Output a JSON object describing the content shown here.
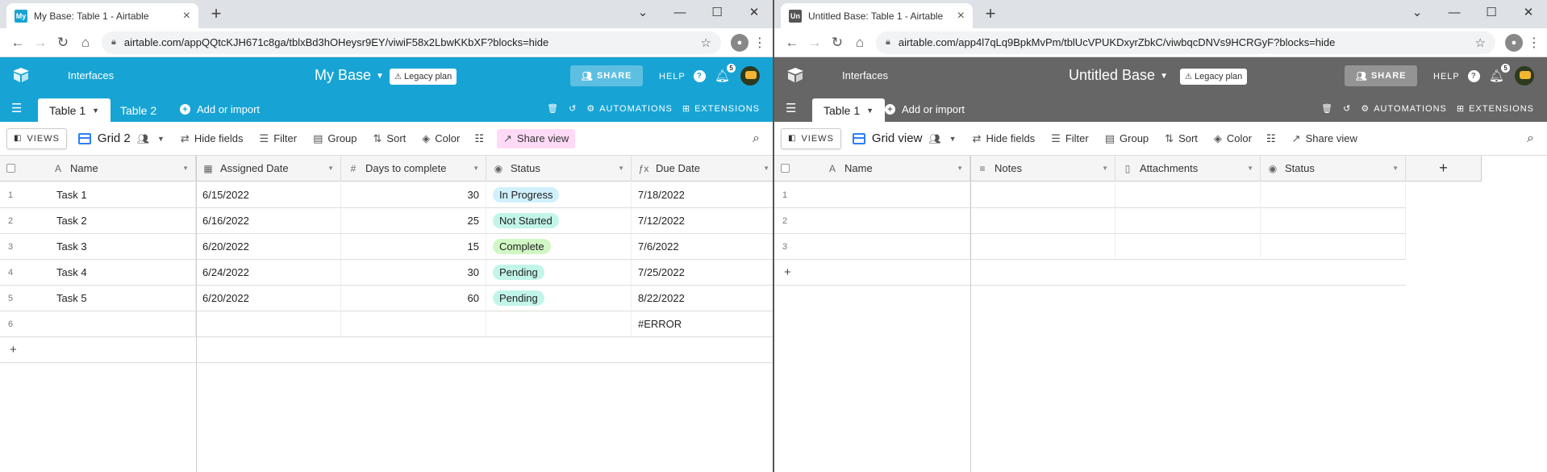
{
  "left": {
    "browser_tab_title": "My Base: Table 1 - Airtable",
    "favicon_text": "My",
    "url": "airtable.com/appQQtcKJH671c8ga/tblxBd3hOHeysr9EY/viwiF58x2LbwKKbXF?blocks=hide",
    "header_color": "#17a4d4",
    "interfaces_label": "Interfaces",
    "base_name": "My Base",
    "legacy_label": "Legacy plan",
    "share_label": "SHARE",
    "help_label": "HELP",
    "notif_count": "5",
    "tabs": [
      {
        "label": "Table 1",
        "active": true
      },
      {
        "label": "Table 2",
        "active": false
      }
    ],
    "add_import_label": "Add or import",
    "automations_label": "AUTOMATIONS",
    "extensions_label": "EXTENSIONS",
    "views_label": "VIEWS",
    "view_name": "Grid 2",
    "toolbar": {
      "hide_fields": "Hide fields",
      "filter": "Filter",
      "group": "Group",
      "sort": "Sort",
      "color": "Color",
      "share_view": "Share view"
    },
    "columns": [
      {
        "name": "Name",
        "icon": "A"
      },
      {
        "name": "Assigned Date",
        "icon": "▦"
      },
      {
        "name": "Days to complete",
        "icon": "#"
      },
      {
        "name": "Status",
        "icon": "◉"
      },
      {
        "name": "Due Date",
        "icon": "ƒx"
      }
    ],
    "rows": [
      {
        "n": "1",
        "name": "Task 1",
        "assigned": "6/15/2022",
        "days": "30",
        "status": "In Progress",
        "status_color": "#d0f0fd",
        "due": "7/18/2022"
      },
      {
        "n": "2",
        "name": "Task 2",
        "assigned": "6/16/2022",
        "days": "25",
        "status": "Not Started",
        "status_color": "#c2f5e9",
        "due": "7/12/2022"
      },
      {
        "n": "3",
        "name": "Task 3",
        "assigned": "6/20/2022",
        "days": "15",
        "status": "Complete",
        "status_color": "#d1f7c4",
        "due": "7/6/2022"
      },
      {
        "n": "4",
        "name": "Task 4",
        "assigned": "6/24/2022",
        "days": "30",
        "status": "Pending",
        "status_color": "#c2f5e9",
        "due": "7/25/2022"
      },
      {
        "n": "5",
        "name": "Task 5",
        "assigned": "6/20/2022",
        "days": "60",
        "status": "Pending",
        "status_color": "#c2f5e9",
        "due": "8/22/2022"
      },
      {
        "n": "6",
        "name": "",
        "assigned": "",
        "days": "",
        "status": "",
        "status_color": "",
        "due": "#ERROR"
      }
    ],
    "add_row_label": "+"
  },
  "right": {
    "browser_tab_title": "Untitled Base: Table 1 - Airtable",
    "favicon_text": "Un",
    "url": "airtable.com/app4l7qLq9BpkMvPm/tblUcVPUKDxyrZbkC/viwbqcDNVs9HCRGyF?blocks=hide",
    "header_color": "#666666",
    "interfaces_label": "Interfaces",
    "base_name": "Untitled Base",
    "legacy_label": "Legacy plan",
    "share_label": "SHARE",
    "help_label": "HELP",
    "notif_count": "5",
    "tabs": [
      {
        "label": "Table 1",
        "active": true
      }
    ],
    "add_import_label": "Add or import",
    "automations_label": "AUTOMATIONS",
    "extensions_label": "EXTENSIONS",
    "views_label": "VIEWS",
    "view_name": "Grid view",
    "toolbar": {
      "hide_fields": "Hide fields",
      "filter": "Filter",
      "group": "Group",
      "sort": "Sort",
      "color": "Color",
      "share_view": "Share view"
    },
    "columns": [
      {
        "name": "Name",
        "icon": "A"
      },
      {
        "name": "Notes",
        "icon": "≡"
      },
      {
        "name": "Attachments",
        "icon": "▯"
      },
      {
        "name": "Status",
        "icon": "◉"
      }
    ],
    "rows": [
      {
        "n": "1"
      },
      {
        "n": "2"
      },
      {
        "n": "3"
      }
    ],
    "add_row_label": "+",
    "add_col_label": "+"
  }
}
